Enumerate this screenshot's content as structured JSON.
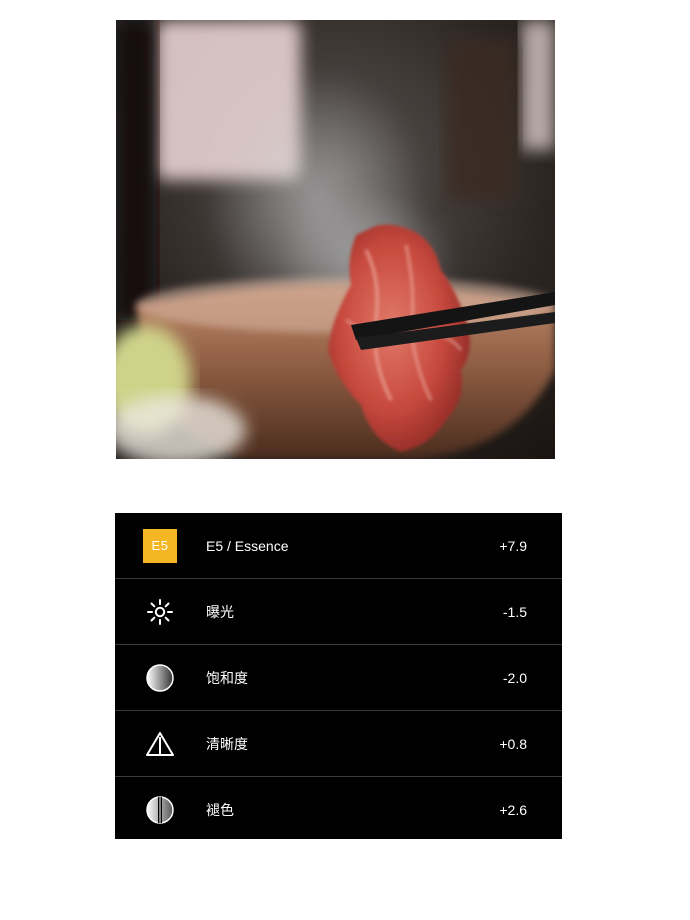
{
  "photo": {
    "subject": "food-photo-hotpot"
  },
  "adjustments": [
    {
      "icon": "preset-badge-icon",
      "badge": "E5",
      "label": "E5 / Essence",
      "value": "+7.9"
    },
    {
      "icon": "exposure-sun-icon",
      "label": "曝光",
      "value": "-1.5"
    },
    {
      "icon": "saturation-circle-icon",
      "label": "饱和度",
      "value": "-2.0"
    },
    {
      "icon": "clarity-triangle-icon",
      "label": "清晰度",
      "value": "+0.8"
    },
    {
      "icon": "fade-circle-icon",
      "label": "褪色",
      "value": "+2.6"
    }
  ],
  "colors": {
    "panel_bg": "#000000",
    "badge_bg": "#f5b623",
    "text": "#ffffff"
  }
}
